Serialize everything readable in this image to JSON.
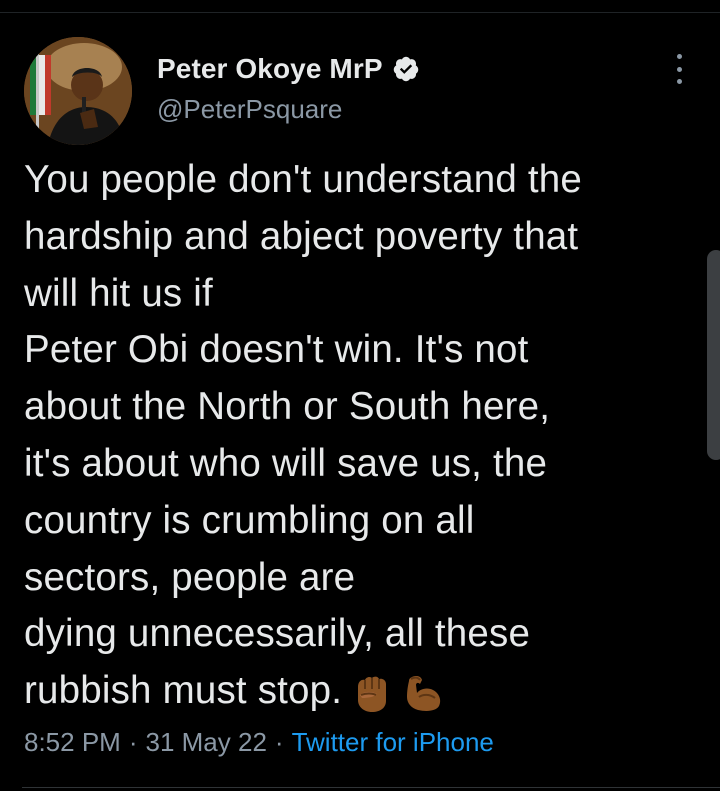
{
  "tweet": {
    "display_name": "Peter Okoye MrP",
    "handle": "@PeterPsquare",
    "verified": true,
    "text": "You people don't understand the\nhardship and abject poverty that\nwill hit us if\nPeter Obi doesn't win. It's not\nabout the North or South here,\nit's about who will save us, the\ncountry is crumbling on all\nsectors, people are\ndying unnecessarily, all these\nrubbish must stop.",
    "emojis": [
      "raised-fist-emoji",
      "flexed-biceps-emoji"
    ],
    "time": "8:52 PM",
    "date": "31 May 22",
    "source": "Twitter for iPhone",
    "separator": "·"
  },
  "icons": {
    "verified": "verified-badge-icon",
    "more": "more-vertical-icon"
  },
  "colors": {
    "background": "#000000",
    "primary_text": "#e7e9ea",
    "secondary_text": "#8b98a5",
    "link": "#1d9bf0",
    "emoji_skin": "#8d5524"
  }
}
